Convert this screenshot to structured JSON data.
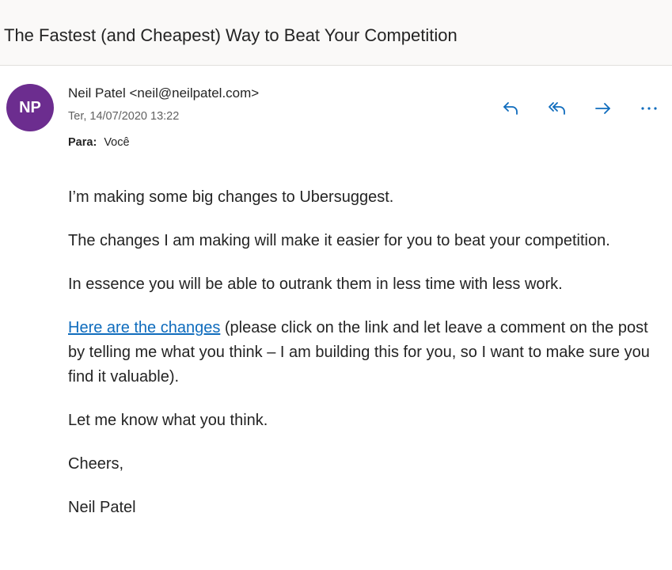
{
  "subject": "The Fastest (and Cheapest) Way to Beat Your Competition",
  "sender": {
    "initials": "NP",
    "display": "Neil Patel <neil@neilpatel.com>",
    "date": "Ter, 14/07/2020 13:22",
    "to_label": "Para:",
    "to_value": "Você",
    "avatar_color": "#6c2d8f"
  },
  "actions": {
    "icons": [
      "reply-icon",
      "reply-all-icon",
      "forward-icon",
      "more-icon"
    ],
    "accent": "#0f6cbd"
  },
  "body": {
    "p1": "I’m making some big changes to Ubersuggest.",
    "p2": "The changes I am making will make it easier for you to beat your competition.",
    "p3": "In essence you will be able to outrank them in less time with less work.",
    "link_text": "Here are the changes",
    "p4_rest": " (please click on the link and let leave a comment on the post by telling me what you think – I am building this for you, so I want to make sure you find it valuable).",
    "p5": "Let me know what you think.",
    "p6": "Cheers,",
    "p7": "Neil Patel"
  }
}
